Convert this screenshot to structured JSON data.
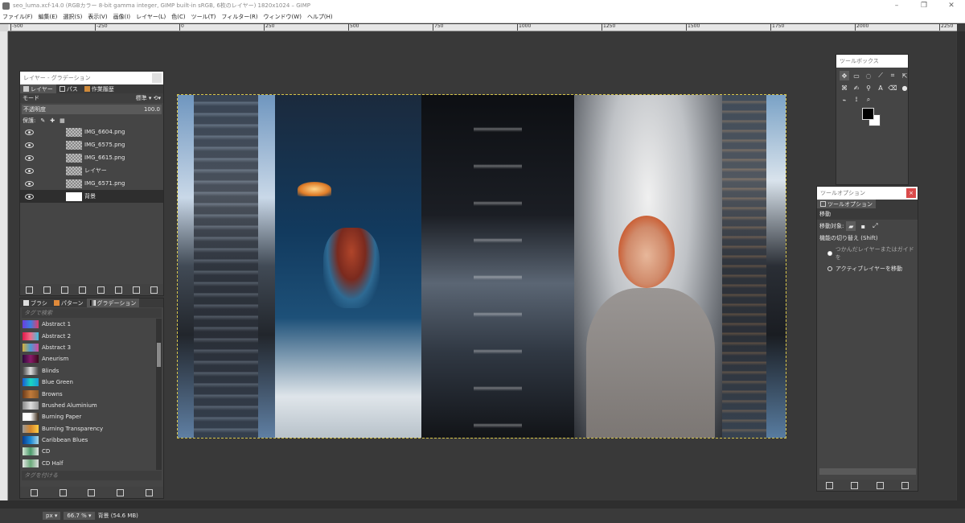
{
  "window": {
    "title": "seo_luma.xcf-14.0 (RGBカラー 8-bit gamma integer, GIMP built-in sRGB, 6枚のレイヤー) 1820x1024 – GIMP"
  },
  "menu": [
    "ファイル(F)",
    "編集(E)",
    "選択(S)",
    "表示(V)",
    "画像(I)",
    "レイヤー(L)",
    "色(C)",
    "ツール(T)",
    "フィルター(R)",
    "ウィンドウ(W)",
    "ヘルプ(H)"
  ],
  "ruler": {
    "ticks": [
      "-500",
      "-250",
      "0",
      "250",
      "500",
      "750",
      "1000",
      "1250",
      "1500",
      "1750",
      "2000",
      "2250"
    ]
  },
  "layers_dock": {
    "title": "レイヤー - グラデーション",
    "tabs": [
      "レイヤー",
      "パス",
      "作業履歴"
    ],
    "mode_label": "モード",
    "mode_value": "標準",
    "opacity_label": "不透明度",
    "opacity_value": "100.0",
    "lock_label": "保護:",
    "layers": [
      {
        "name": "IMG_6604.png"
      },
      {
        "name": "IMG_6575.png"
      },
      {
        "name": "IMG_6615.png"
      },
      {
        "name": "レイヤー"
      },
      {
        "name": "IMG_6571.png"
      },
      {
        "name": "背景"
      }
    ]
  },
  "gradient_dock": {
    "tabs": [
      "ブラシ",
      "パターン",
      "グラデーション"
    ],
    "search_placeholder": "タグで検索",
    "tag_placeholder": "タグを付ける",
    "gradients": [
      {
        "name": "Abstract 1",
        "colors": [
          "#6b3de0",
          "#3d7de0",
          "#e03d6b"
        ]
      },
      {
        "name": "Abstract 2",
        "colors": [
          "#e0194a",
          "#f06e8a",
          "#3dc0e0"
        ]
      },
      {
        "name": "Abstract 3",
        "colors": [
          "#d6b03a",
          "#4a9ad6",
          "#d64a9a"
        ]
      },
      {
        "name": "Aneurism",
        "colors": [
          "#2a0a3a",
          "#8a1a6a",
          "#3a0a1a"
        ]
      },
      {
        "name": "Blinds",
        "colors": [
          "#444444",
          "#dddddd",
          "#444444"
        ]
      },
      {
        "name": "Blue Green",
        "colors": [
          "#1a5ad6",
          "#1ad6c0",
          "#1a9ad6"
        ]
      },
      {
        "name": "Browns",
        "colors": [
          "#6a3a1a",
          "#c07a3a",
          "#8a5a2a"
        ]
      },
      {
        "name": "Brushed Aluminium",
        "colors": [
          "#8a8a8a",
          "#dddddd",
          "#9a9a9a"
        ]
      },
      {
        "name": "Burning Paper",
        "colors": [
          "#ffffff",
          "#ffffff",
          "#3a2a1a"
        ]
      },
      {
        "name": "Burning Transparency",
        "colors": [
          "#999999",
          "#d6862a",
          "#ffcc44"
        ]
      },
      {
        "name": "Caribbean Blues",
        "colors": [
          "#0a3a8a",
          "#1a8ad6",
          "#aad6e6"
        ]
      },
      {
        "name": "CD",
        "colors": [
          "#d6e6d6",
          "#4a9a6a",
          "#e6e6e6"
        ]
      },
      {
        "name": "CD Half",
        "colors": [
          "#e6e6e6",
          "#6aaa7a",
          "#dddddd"
        ]
      }
    ]
  },
  "toolbox": {
    "title": "ツールボックス",
    "tools": [
      "move",
      "align",
      "lasso",
      "fuzzy-select",
      "crop",
      "transform",
      "warp",
      "paint",
      "clone",
      "text",
      "eraser",
      "smudge",
      "path",
      "color-picker",
      "zoom",
      "measure"
    ],
    "fg_color": "#000000",
    "bg_color": "#ffffff"
  },
  "tool_options": {
    "title": "ツールオプション",
    "tab": "ツールオプション",
    "tool_name": "移動",
    "target_label": "移動対象:",
    "toggle_label": "機能の切り替え (Shift)",
    "options": [
      "つかんだレイヤーまたはガイドを",
      "アクティブレイヤーを移動"
    ]
  },
  "status": {
    "unit": "px",
    "zoom": "66.7 %",
    "info": "背景 (54.6 MB)"
  }
}
